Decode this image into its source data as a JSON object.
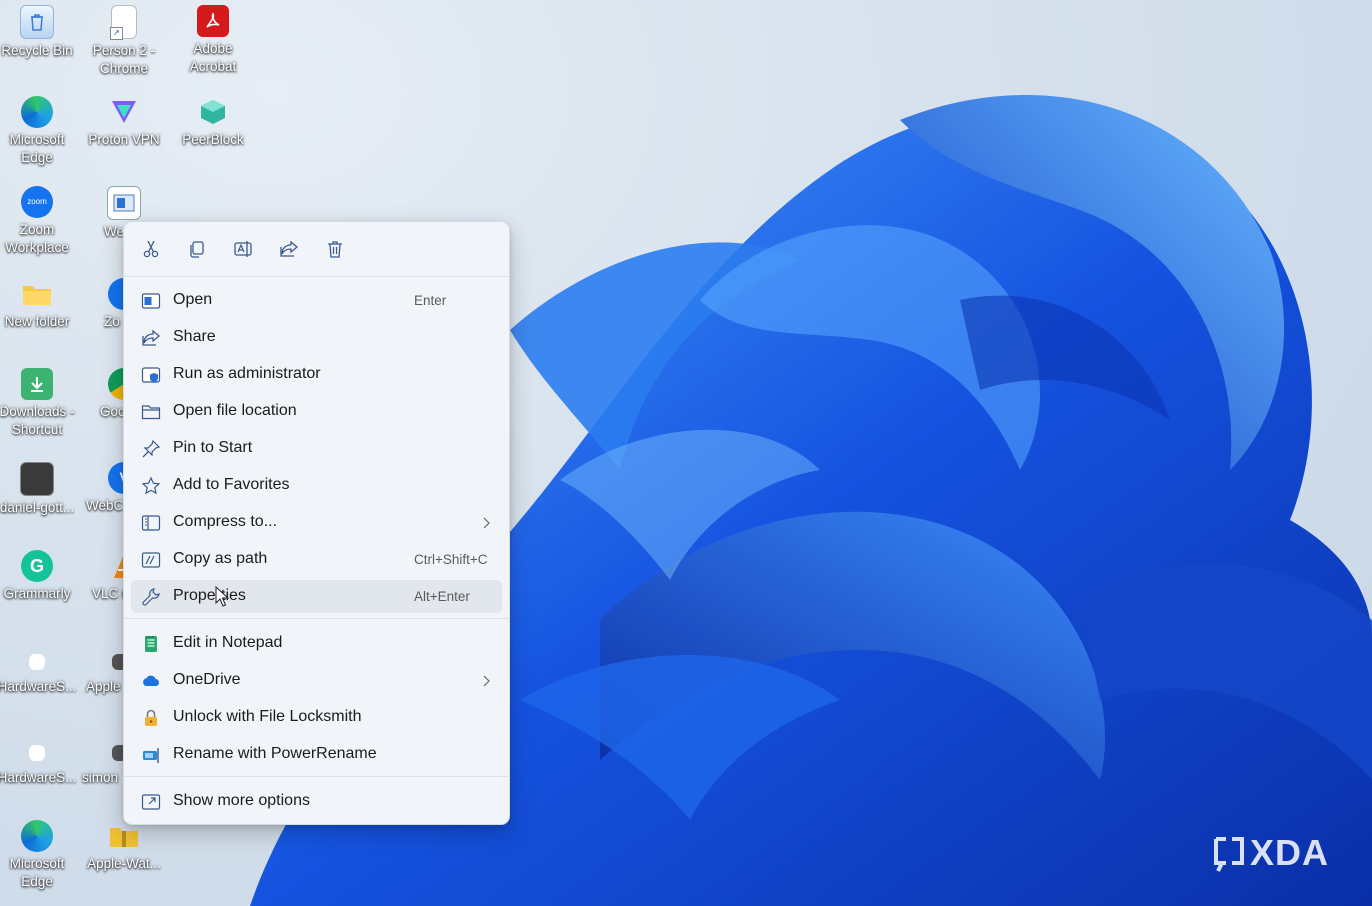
{
  "desktop_icons": [
    {
      "label": "Recycle Bin",
      "icon": "recycle-bin-icon"
    },
    {
      "label": "Person 2 - Chrome",
      "icon": "document-icon"
    },
    {
      "label": "Adobe Acrobat",
      "icon": "acrobat-icon"
    },
    {
      "label": "Microsoft Edge",
      "icon": "edge-icon"
    },
    {
      "label": "Proton VPN",
      "icon": "proton-vpn-icon"
    },
    {
      "label": "PeerBlock",
      "icon": "peerblock-icon"
    },
    {
      "label": "Zoom Workplace",
      "icon": "zoom-icon"
    },
    {
      "label": "We",
      "icon": "app-window-icon"
    },
    {
      "label": "New folder",
      "icon": "folder-icon"
    },
    {
      "label": "Zo",
      "icon": "zoom-icon"
    },
    {
      "label": "Downloads - Shortcut",
      "icon": "downloads-icon"
    },
    {
      "label": "Goc Chr",
      "icon": "chrome-icon"
    },
    {
      "label": "daniel-gott...",
      "icon": "image-file-icon"
    },
    {
      "label": "WebC",
      "icon": "webcam-icon"
    },
    {
      "label": "Grammarly",
      "icon": "grammarly-icon"
    },
    {
      "label": "VLC r pla",
      "icon": "vlc-icon"
    },
    {
      "label": "HardwareS...",
      "icon": "blank-file-icon"
    },
    {
      "label": "Apple",
      "icon": "image-file-icon"
    },
    {
      "label": "HardwareS...",
      "icon": "blank-file-icon"
    },
    {
      "label": "simon",
      "icon": "image-file-icon"
    },
    {
      "label": "Microsoft Edge",
      "icon": "edge-icon"
    },
    {
      "label": "Apple-Wat...",
      "icon": "zip-folder-icon"
    }
  ],
  "context_menu": {
    "quick_actions": [
      {
        "name": "cut",
        "icon": "scissors-icon"
      },
      {
        "name": "copy",
        "icon": "copy-icon"
      },
      {
        "name": "rename",
        "icon": "rename-icon"
      },
      {
        "name": "share",
        "icon": "share-icon"
      },
      {
        "name": "delete",
        "icon": "trash-icon"
      }
    ],
    "items": [
      {
        "label": "Open",
        "shortcut": "Enter",
        "icon": "open-window-icon"
      },
      {
        "label": "Share",
        "shortcut": "",
        "icon": "share-icon"
      },
      {
        "label": "Run as administrator",
        "shortcut": "",
        "icon": "shield-icon"
      },
      {
        "label": "Open file location",
        "shortcut": "",
        "icon": "folder-outline-icon"
      },
      {
        "label": "Pin to Start",
        "shortcut": "",
        "icon": "pin-icon"
      },
      {
        "label": "Add to Favorites",
        "shortcut": "",
        "icon": "star-icon"
      },
      {
        "label": "Compress to...",
        "shortcut": "",
        "icon": "zip-icon",
        "submenu": true
      },
      {
        "label": "Copy as path",
        "shortcut": "Ctrl+Shift+C",
        "icon": "path-icon"
      },
      {
        "label": "Properties",
        "shortcut": "Alt+Enter",
        "icon": "wrench-icon",
        "highlighted": true
      },
      {
        "label": "Edit in Notepad",
        "shortcut": "",
        "icon": "notepad-icon"
      },
      {
        "label": "OneDrive",
        "shortcut": "",
        "icon": "cloud-icon",
        "submenu": true
      },
      {
        "label": "Unlock with File Locksmith",
        "shortcut": "",
        "icon": "lock-icon"
      },
      {
        "label": "Rename with PowerRename",
        "shortcut": "",
        "icon": "power-rename-icon"
      },
      {
        "label": "Show more options",
        "shortcut": "",
        "icon": "expand-icon"
      }
    ]
  },
  "watermark": {
    "text": "XDA"
  },
  "colors": {
    "accent": "#1a5fd6",
    "menu_bg": "#f1f4f9",
    "hover": "#e2e7ee"
  }
}
